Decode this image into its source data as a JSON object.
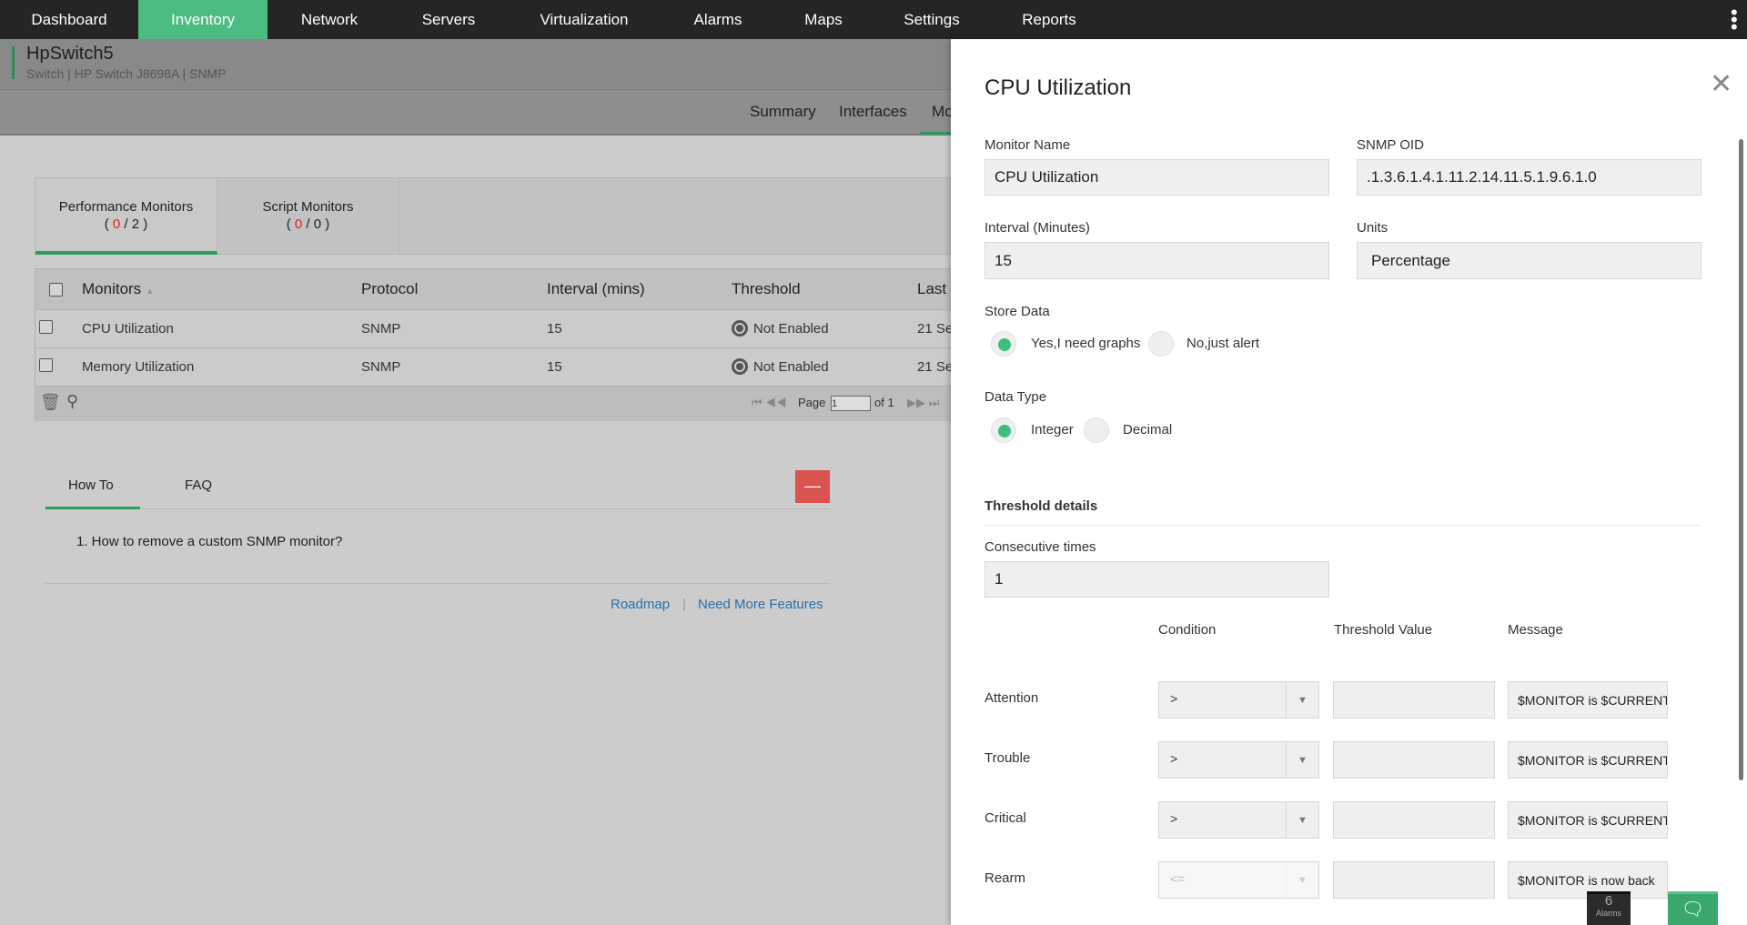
{
  "nav": {
    "items": [
      {
        "label": "Dashboard",
        "active": false
      },
      {
        "label": "Inventory",
        "active": true
      },
      {
        "label": "Network",
        "active": false
      },
      {
        "label": "Servers",
        "active": false
      },
      {
        "label": "Virtualization",
        "active": false
      },
      {
        "label": "Alarms",
        "active": false
      },
      {
        "label": "Maps",
        "active": false
      },
      {
        "label": "Settings",
        "active": false
      },
      {
        "label": "Reports",
        "active": false
      }
    ],
    "menu_icon": "kebab-vertical-icon",
    "accent": "#4bbd82"
  },
  "device": {
    "name": "HpSwitch5",
    "subtitle": "Switch | HP Switch J8698A  | SNMP"
  },
  "subnav": {
    "items": [
      "Summary",
      "Interfaces",
      "Mo"
    ]
  },
  "monitor_tabs": [
    {
      "label": "Performance Monitors",
      "count_a": "0",
      "count_b": "2"
    },
    {
      "label": "Script Monitors",
      "count_a": "0",
      "count_b": "0"
    }
  ],
  "table": {
    "headers": [
      "Monitors",
      "Protocol",
      "Interval (mins)",
      "Threshold",
      "Last I"
    ],
    "rows": [
      {
        "name": "CPU Utilization",
        "protocol": "SNMP",
        "interval": "15",
        "threshold": "Not Enabled",
        "last": "21 Se"
      },
      {
        "name": "Memory Utilization",
        "protocol": "SNMP",
        "interval": "15",
        "threshold": "Not Enabled",
        "last": "21 Se"
      }
    ],
    "pager": {
      "page_label": "Page",
      "page": "1",
      "of_label": "of 1"
    }
  },
  "howto": {
    "tabs": [
      "How To",
      "FAQ"
    ],
    "collapse_label": "—",
    "items": [
      "1. How to remove a custom SNMP monitor?"
    ],
    "links": [
      "Roadmap",
      "Need More Features"
    ],
    "separator": "|"
  },
  "panel": {
    "title": "CPU Utilization",
    "monitor_name": {
      "label": "Monitor Name",
      "value": "CPU Utilization"
    },
    "snmp_oid": {
      "label": "SNMP OID",
      "value": ".1.3.6.1.4.1.11.2.14.11.5.1.9.6.1.0"
    },
    "interval": {
      "label": "Interval (Minutes)",
      "value": "15"
    },
    "units": {
      "label": "Units",
      "value": "Percentage"
    },
    "store_data": {
      "label": "Store Data",
      "options": [
        "Yes,I need graphs",
        "No,just alert"
      ],
      "selected": 0
    },
    "data_type": {
      "label": "Data Type",
      "options": [
        "Integer",
        "Decimal"
      ],
      "selected": 0
    },
    "threshold_heading": "Threshold details",
    "consecutive": {
      "label": "Consecutive times",
      "value": "1"
    },
    "columns": [
      "Condition",
      "Threshold Value",
      "Message"
    ],
    "rows": [
      {
        "label": "Attention",
        "condition": ">",
        "value": "",
        "message": "$MONITOR is $CURRENT",
        "disabled": false
      },
      {
        "label": "Trouble",
        "condition": ">",
        "value": "",
        "message": "$MONITOR is $CURRENT",
        "disabled": false
      },
      {
        "label": "Critical",
        "condition": ">",
        "value": "",
        "message": "$MONITOR is $CURRENT",
        "disabled": false
      },
      {
        "label": "Rearm",
        "condition": "<=",
        "value": "",
        "message": "$MONITOR is now back",
        "disabled": true
      }
    ]
  },
  "alarms_badge": {
    "count": "6",
    "label": "Alarms"
  },
  "chat_icon": "chat-bubbles-icon"
}
